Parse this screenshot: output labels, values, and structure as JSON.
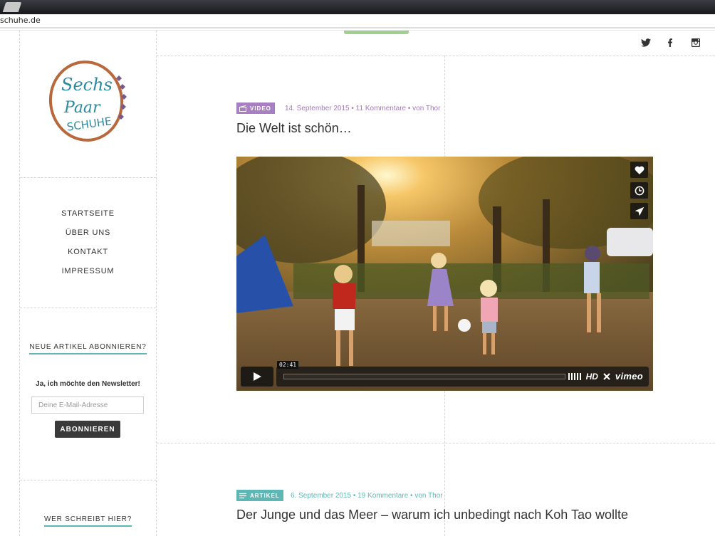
{
  "browser": {
    "url": "schuhe.de"
  },
  "logo": {
    "line1": "Sechs",
    "line2": "Paar",
    "line3": "SCHUHE"
  },
  "social": [
    "twitter-icon",
    "facebook-icon",
    "instagram-icon"
  ],
  "nav": {
    "items": [
      {
        "label": "STARTSEITE"
      },
      {
        "label": "ÜBER UNS"
      },
      {
        "label": "KONTAKT"
      },
      {
        "label": "IMPRESSUM"
      }
    ]
  },
  "sidebar": {
    "subscribe_heading": "NEUE ARTIKEL ABONNIEREN?",
    "newsletter_label": "Ja, ich möchte den Newsletter!",
    "email_placeholder": "Deine E-Mail-Adresse",
    "subscribe_button": "ABONNIEREN",
    "author_heading": "WER SCHREIBT HIER?"
  },
  "posts": [
    {
      "category": "VIDEO",
      "meta": "14. September 2015 • 11 Kommentare • von Thor",
      "title": "Die Welt ist schön…",
      "video": {
        "timecode": "02:41",
        "hd_label": "HD",
        "brand": "vimeo"
      }
    },
    {
      "category": "ARTIKEL",
      "meta": "6. September 2015 • 19 Kommentare • von Thor",
      "title": "Der Junge und das Meer – warum ich unbedingt nach Koh Tao wollte"
    }
  ],
  "colors": {
    "video_accent": "#a87fc2",
    "article_accent": "#5fb7b5",
    "button_dark": "#3a3a3a"
  }
}
